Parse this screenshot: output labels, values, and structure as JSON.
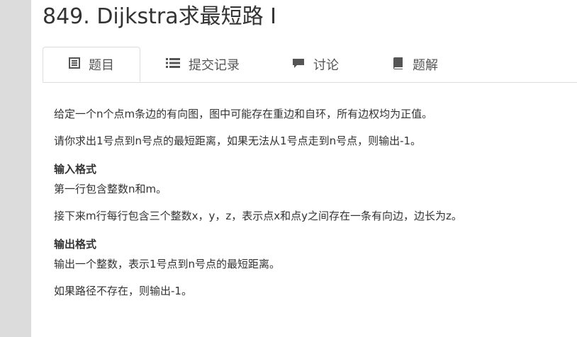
{
  "problem": {
    "title": "849. Dijkstra求最短路 I"
  },
  "tabs": [
    {
      "label": "题目",
      "icon": "document-icon",
      "active": true
    },
    {
      "label": "提交记录",
      "icon": "list-icon",
      "active": false
    },
    {
      "label": "讨论",
      "icon": "comment-icon",
      "active": false
    },
    {
      "label": "题解",
      "icon": "book-icon",
      "active": false
    }
  ],
  "description": {
    "p1": "给定一个n个点m条边的有向图，图中可能存在重边和自环，所有边权均为正值。",
    "p2": "请你求出1号点到n号点的最短距离，如果无法从1号点走到n号点，则输出-1。"
  },
  "input_format": {
    "heading": "输入格式",
    "p1": "第一行包含整数n和m。",
    "p2": "接下来m行每行包含三个整数x，y，z，表示点x和点y之间存在一条有向边，边长为z。"
  },
  "output_format": {
    "heading": "输出格式",
    "p1": "输出一个整数，表示1号点到n号点的最短距离。",
    "p2": "如果路径不存在，则输出-1。"
  },
  "colors": {
    "text": "#333333",
    "tab_text": "#555555",
    "border": "#dddddd",
    "backdrop": "#dcdcdc"
  }
}
